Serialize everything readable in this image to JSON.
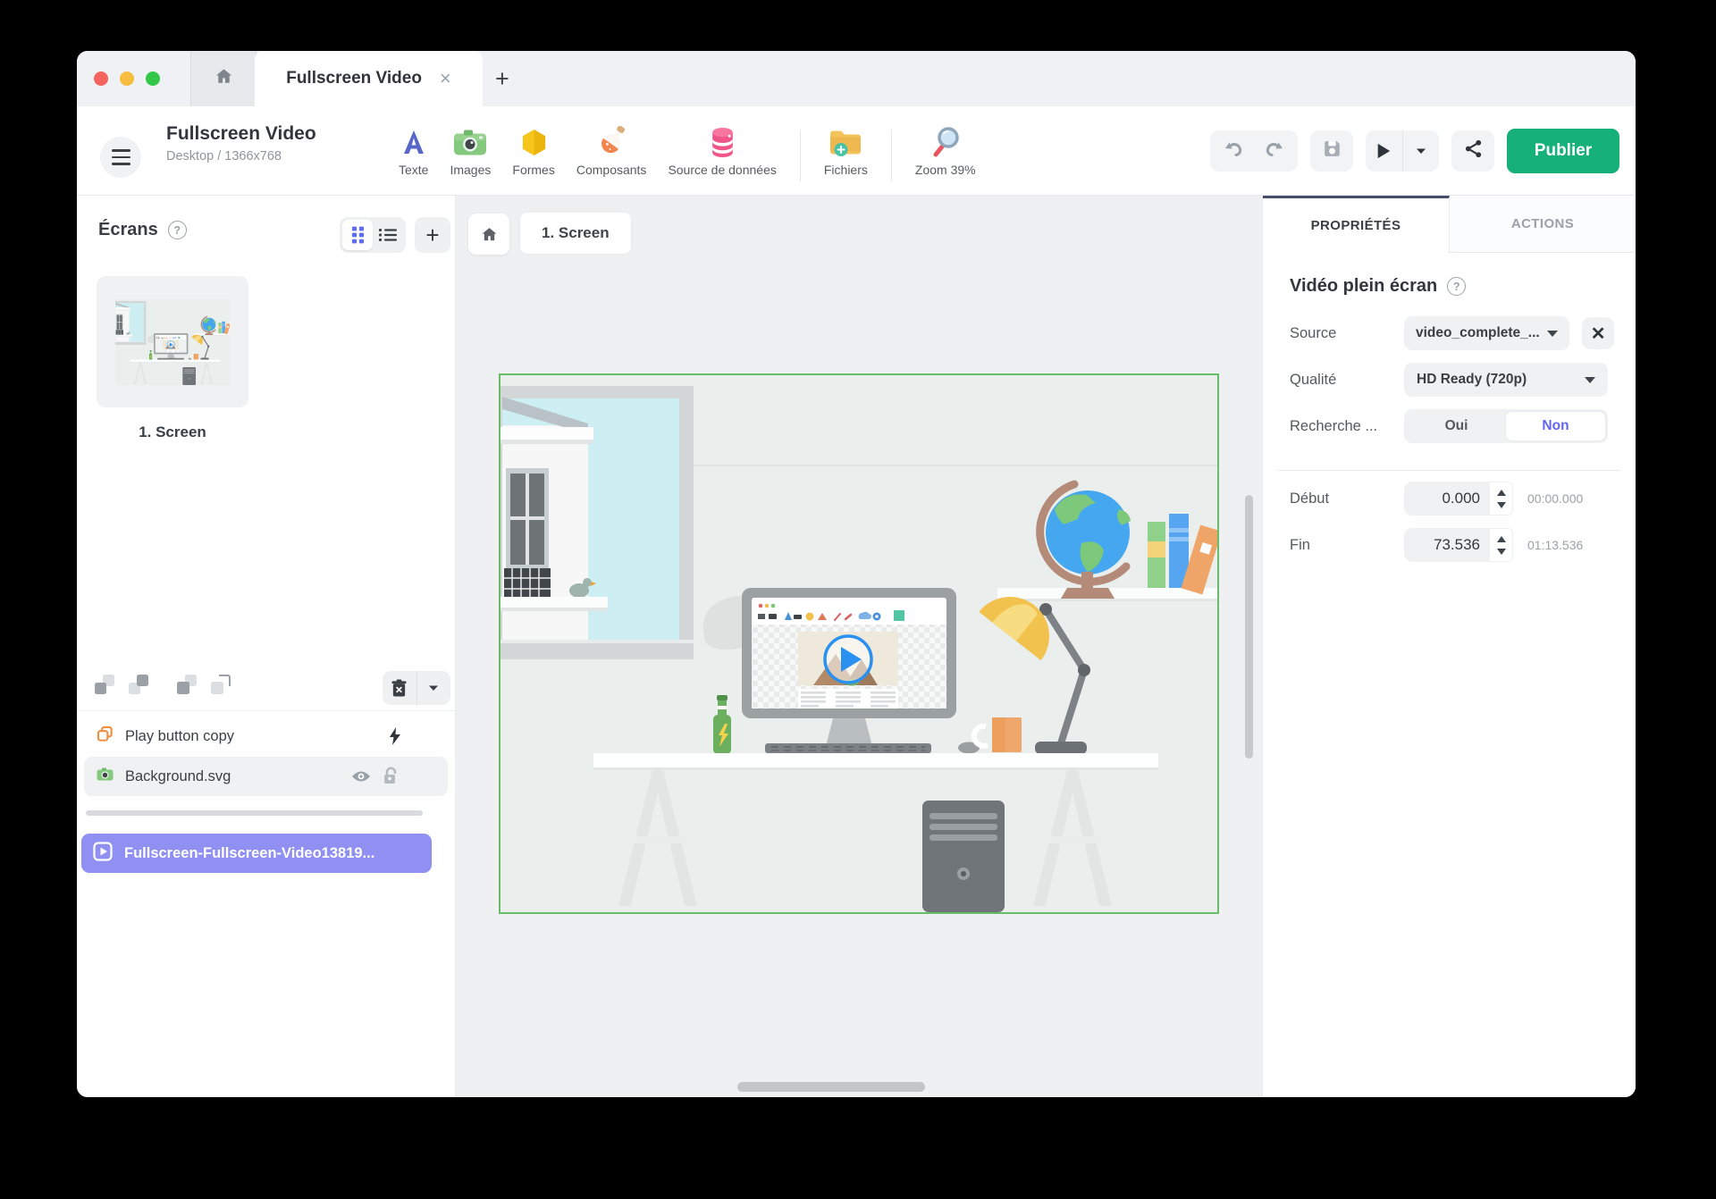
{
  "window": {
    "tab": {
      "title": "Fullscreen Video"
    }
  },
  "toolbar": {
    "title": "Fullscreen Video",
    "subtitle": "Desktop / 1366x768",
    "tools": [
      {
        "label": "Texte"
      },
      {
        "label": "Images"
      },
      {
        "label": "Formes"
      },
      {
        "label": "Composants"
      },
      {
        "label": "Source de données"
      },
      {
        "label": "Fichiers"
      },
      {
        "label": "Zoom 39%"
      }
    ],
    "publish_label": "Publier"
  },
  "screens_panel": {
    "title": "Écrans",
    "screens": [
      {
        "label": "1. Screen"
      }
    ]
  },
  "layers_panel": {
    "items": [
      {
        "name": "Play button copy"
      },
      {
        "name": "Background.svg"
      }
    ],
    "selected": {
      "name": "Fullscreen-Fullscreen-Video13819..."
    }
  },
  "canvas": {
    "breadcrumb": {
      "screen": "1. Screen"
    }
  },
  "properties_panel": {
    "tabs": {
      "properties": "PROPRIÉTÉS",
      "actions": "ACTIONS"
    },
    "section_title": "Vidéo plein écran",
    "source": {
      "label": "Source",
      "value": "video_complete_..."
    },
    "quality": {
      "label": "Qualité",
      "value": "HD Ready (720p)"
    },
    "seek": {
      "label": "Recherche ...",
      "yes": "Oui",
      "no": "Non"
    },
    "start": {
      "label": "Début",
      "value": "0.000",
      "time": "00:00.000"
    },
    "end": {
      "label": "Fin",
      "value": "73.536",
      "time": "01:13.536"
    }
  },
  "colors": {
    "publish_green": "#16b179",
    "selected_purple": "#8f90f2",
    "accent_blue": "#5d6cf5",
    "toggle_purple": "#6165f2",
    "artboard_border": "#69bd69"
  }
}
